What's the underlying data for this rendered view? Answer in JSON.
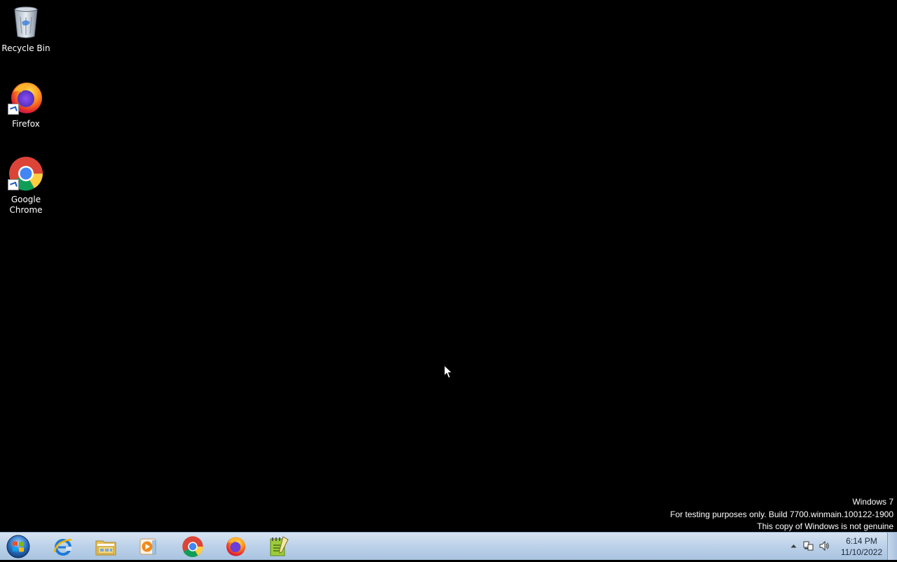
{
  "desktop": {
    "icons": [
      {
        "label": "Recycle Bin",
        "icon": "recycle-bin-icon"
      },
      {
        "label": "Firefox",
        "icon": "firefox-icon"
      },
      {
        "label": "Google\nChrome",
        "icon": "chrome-icon"
      }
    ]
  },
  "watermark": {
    "line1": "Windows 7",
    "line2": "For testing purposes only. Build 7700.winmain.100122-1900",
    "line3": "This copy of Windows is not genuine"
  },
  "taskbar": {
    "start": {
      "icon": "windows-start-icon"
    },
    "pinned": [
      {
        "name": "Internet Explorer",
        "icon": "internet-explorer-icon"
      },
      {
        "name": "Windows Explorer",
        "icon": "file-explorer-icon"
      },
      {
        "name": "Windows Media Player",
        "icon": "media-player-icon"
      },
      {
        "name": "Google Chrome",
        "icon": "chrome-icon"
      },
      {
        "name": "Firefox",
        "icon": "firefox-icon"
      },
      {
        "name": "Notepad++",
        "icon": "notepad-icon"
      }
    ],
    "tray": {
      "time": "6:14 PM",
      "date": "11/10/2022",
      "icons": [
        "show-hidden-icons-arrow",
        "network-icon",
        "volume-icon"
      ]
    }
  },
  "colors": {
    "desktop_bg": "#000000",
    "taskbar_top": "#d6e3f1",
    "taskbar_bottom": "#a9c3e0"
  }
}
